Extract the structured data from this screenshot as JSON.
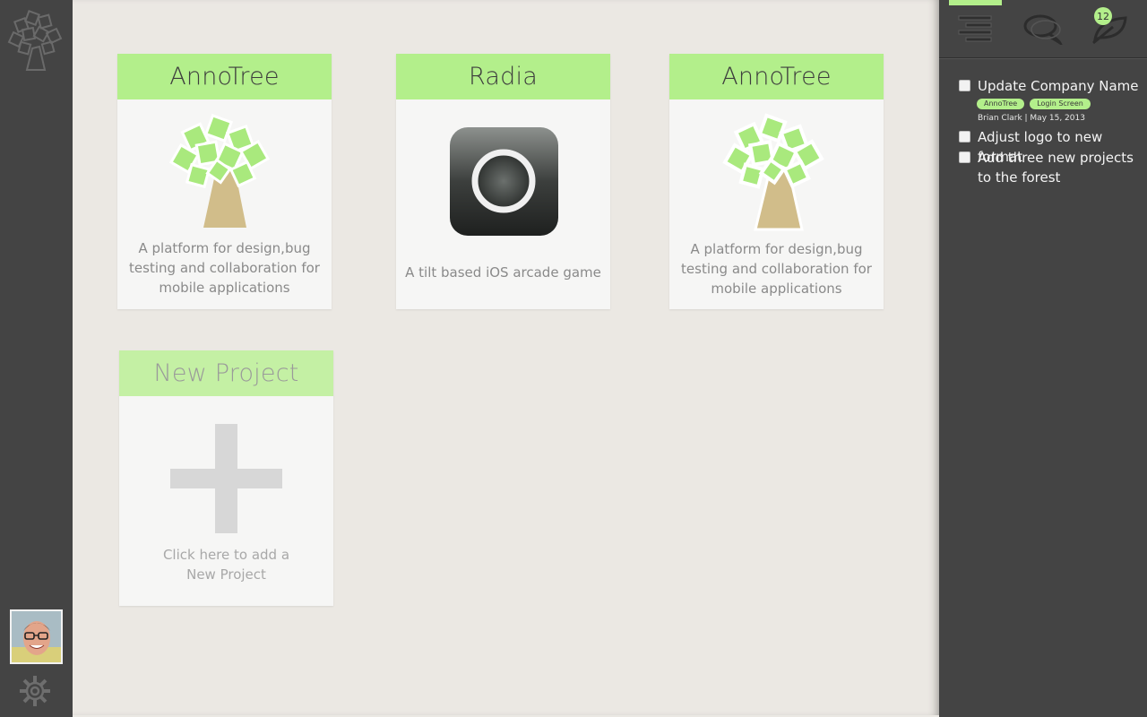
{
  "projects": [
    {
      "title": "AnnoTree",
      "description": "A platform for design,bug testing and collaboration for mobile applications",
      "icon": "tree-logo-icon"
    },
    {
      "title": "Radia",
      "description": "A tilt based iOS arcade game",
      "icon": "radia-app-icon"
    },
    {
      "title": "AnnoTree",
      "description": "A platform for design,bug testing and collaboration for mobile applications",
      "icon": "tree-logo-icon"
    }
  ],
  "new_project": {
    "title": "New Project",
    "description": "Click here to add a New Project",
    "icon": "plus-icon"
  },
  "panel": {
    "notification_count": "12",
    "tabs": [
      "list-icon",
      "chat-icon",
      "leaf-icon"
    ],
    "todos": [
      {
        "label": "Update Company Name",
        "checked": false
      },
      {
        "label": "Adjust logo to new format",
        "checked": false
      },
      {
        "label": "Add three new projects to the forest",
        "checked": false
      }
    ],
    "tags": [
      "AnnoTree",
      "Login Screen"
    ],
    "meta": "Brian Clark | May 15, 2013"
  },
  "colors": {
    "accent": "#b3ef8b",
    "sidebar": "#444444",
    "background": "#ebe8e3"
  }
}
